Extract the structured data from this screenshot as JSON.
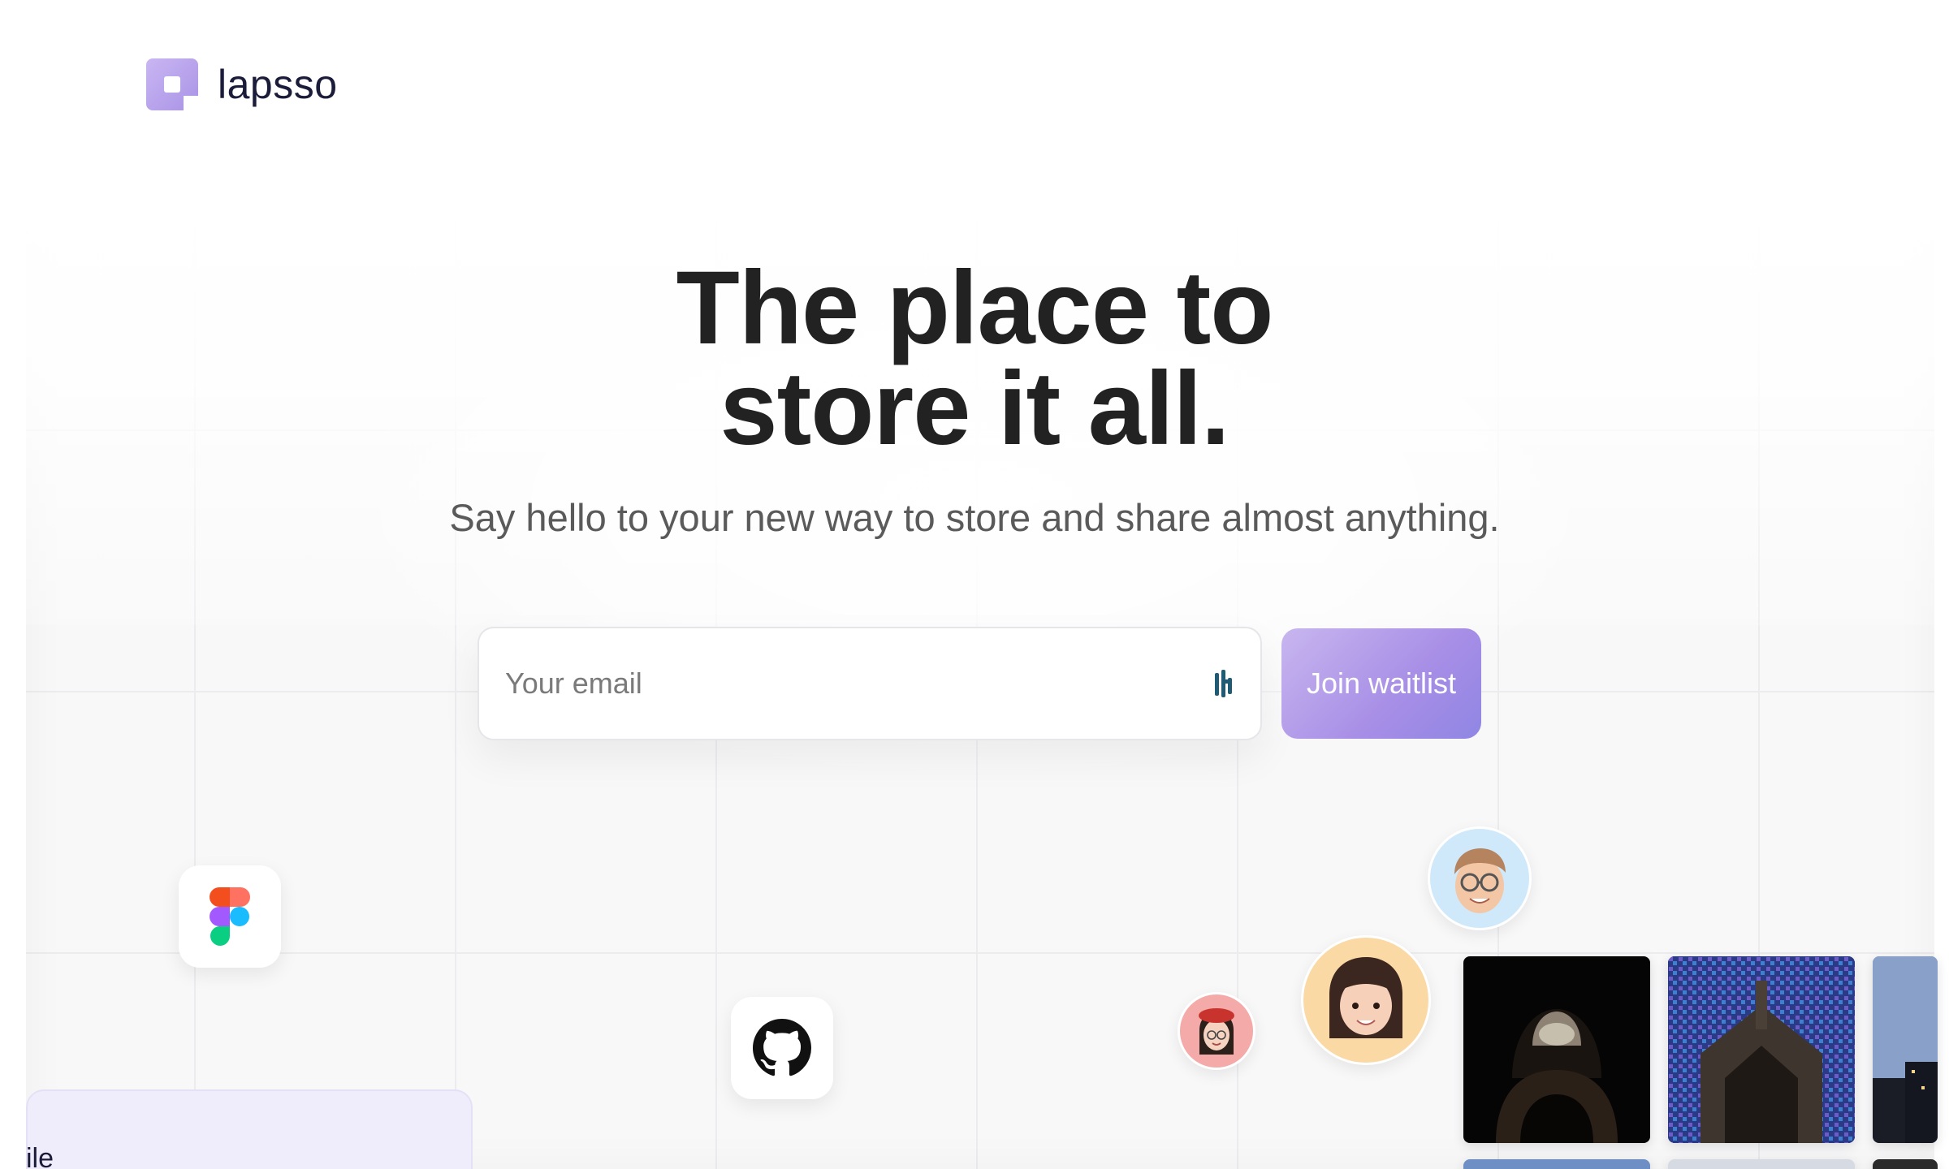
{
  "brand": {
    "name": "lapsso"
  },
  "hero": {
    "title_line1": "The place to",
    "title_line2": "store it all.",
    "subtitle": "Say hello to your new way to store and share almost anything."
  },
  "signup": {
    "email_placeholder": "Your email",
    "cta_label": "Join waitlist"
  },
  "floating_icons": [
    "figma-icon",
    "github-icon"
  ],
  "avatars": [
    "avatar-glasses-man",
    "avatar-brown-hair-woman",
    "avatar-red-beret-woman"
  ],
  "photos": [
    "photo-dome-interior",
    "photo-stained-glass-chapel",
    "photo-city-skyline"
  ],
  "bottom_card": {
    "label": "ile"
  },
  "colors": {
    "accent": "#a993e6",
    "cta_gradient_end": "#8f86e4",
    "text_dark": "#222222"
  }
}
